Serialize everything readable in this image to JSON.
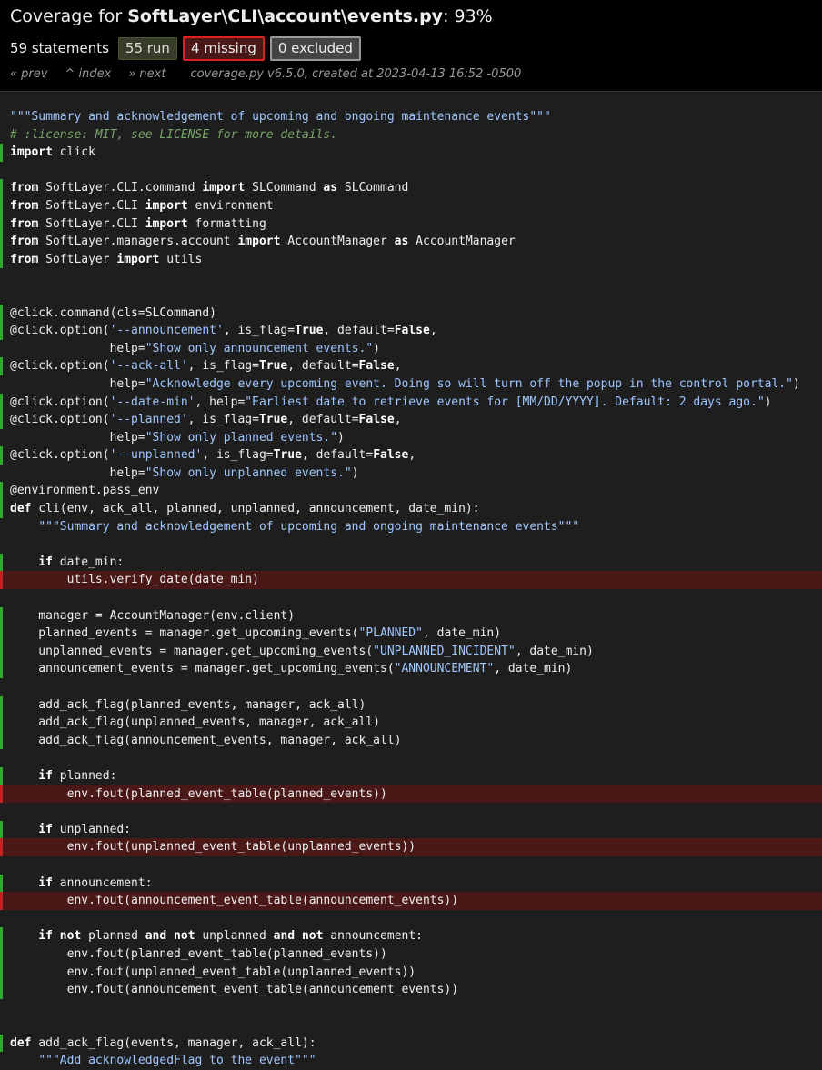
{
  "header": {
    "title_prefix": "Coverage for ",
    "file_path": "SoftLayer\\CLI\\account\\events.py",
    "title_suffix": ": 93%",
    "statements": "59 statements",
    "run_badge": "55 run",
    "missing_badge": "4 missing",
    "excluded_badge": "0 excluded",
    "nav_prev": "« prev",
    "nav_index": "^ index",
    "nav_next": "» next",
    "meta": "coverage.py v6.5.0, created at 2023-04-13 16:52 -0500"
  },
  "colors": {
    "run_marker": "#2ea82e",
    "missing_marker": "#c22323",
    "missing_background": "#4b1818",
    "header_background": "#000000",
    "page_background": "#1e1e1e"
  },
  "source_lines": [
    {
      "s": "",
      "t": [
        [
          "str",
          "\"\"\"Summary and acknowledgement of upcoming and ongoing maintenance events\"\"\""
        ]
      ]
    },
    {
      "s": "",
      "t": [
        [
          "com",
          "# :license: MIT, see LICENSE for more details."
        ]
      ]
    },
    {
      "s": "run",
      "t": [
        [
          "kw",
          "import"
        ],
        [
          "",
          " click"
        ]
      ]
    },
    {
      "s": "",
      "t": []
    },
    {
      "s": "run",
      "t": [
        [
          "kw",
          "from"
        ],
        [
          "",
          " SoftLayer.CLI.command "
        ],
        [
          "kw",
          "import"
        ],
        [
          "",
          " SLCommand "
        ],
        [
          "kw",
          "as"
        ],
        [
          "",
          " SLCommand"
        ]
      ]
    },
    {
      "s": "run",
      "t": [
        [
          "kw",
          "from"
        ],
        [
          "",
          " SoftLayer.CLI "
        ],
        [
          "kw",
          "import"
        ],
        [
          "",
          " environment"
        ]
      ]
    },
    {
      "s": "run",
      "t": [
        [
          "kw",
          "from"
        ],
        [
          "",
          " SoftLayer.CLI "
        ],
        [
          "kw",
          "import"
        ],
        [
          "",
          " formatting"
        ]
      ]
    },
    {
      "s": "run",
      "t": [
        [
          "kw",
          "from"
        ],
        [
          "",
          " SoftLayer.managers.account "
        ],
        [
          "kw",
          "import"
        ],
        [
          "",
          " AccountManager "
        ],
        [
          "kw",
          "as"
        ],
        [
          "",
          " AccountManager"
        ]
      ]
    },
    {
      "s": "run",
      "t": [
        [
          "kw",
          "from"
        ],
        [
          "",
          " SoftLayer "
        ],
        [
          "kw",
          "import"
        ],
        [
          "",
          " utils"
        ]
      ]
    },
    {
      "s": "",
      "t": []
    },
    {
      "s": "",
      "t": []
    },
    {
      "s": "run",
      "t": [
        [
          "",
          "@click.command(cls=SLCommand)"
        ]
      ]
    },
    {
      "s": "run",
      "t": [
        [
          "",
          "@click.option("
        ],
        [
          "str",
          "'--announcement'"
        ],
        [
          "",
          ", is_flag="
        ],
        [
          "kw",
          "True"
        ],
        [
          "",
          ", default="
        ],
        [
          "kw",
          "False"
        ],
        [
          "",
          ","
        ]
      ]
    },
    {
      "s": "",
      "t": [
        [
          "",
          "              help="
        ],
        [
          "str",
          "\"Show only announcement events.\""
        ],
        [
          "",
          ")"
        ]
      ]
    },
    {
      "s": "run",
      "t": [
        [
          "",
          "@click.option("
        ],
        [
          "str",
          "'--ack-all'"
        ],
        [
          "",
          ", is_flag="
        ],
        [
          "kw",
          "True"
        ],
        [
          "",
          ", default="
        ],
        [
          "kw",
          "False"
        ],
        [
          "",
          ","
        ]
      ]
    },
    {
      "s": "",
      "t": [
        [
          "",
          "              help="
        ],
        [
          "str",
          "\"Acknowledge every upcoming event. Doing so will turn off the popup in the control portal.\""
        ],
        [
          "",
          ")"
        ]
      ]
    },
    {
      "s": "run",
      "t": [
        [
          "",
          "@click.option("
        ],
        [
          "str",
          "'--date-min'"
        ],
        [
          "",
          ", help="
        ],
        [
          "str",
          "\"Earliest date to retrieve events for [MM/DD/YYYY]. Default: 2 days ago.\""
        ],
        [
          "",
          ")"
        ]
      ]
    },
    {
      "s": "run",
      "t": [
        [
          "",
          "@click.option("
        ],
        [
          "str",
          "'--planned'"
        ],
        [
          "",
          ", is_flag="
        ],
        [
          "kw",
          "True"
        ],
        [
          "",
          ", default="
        ],
        [
          "kw",
          "False"
        ],
        [
          "",
          ","
        ]
      ]
    },
    {
      "s": "",
      "t": [
        [
          "",
          "              help="
        ],
        [
          "str",
          "\"Show only planned events.\""
        ],
        [
          "",
          ")"
        ]
      ]
    },
    {
      "s": "run",
      "t": [
        [
          "",
          "@click.option("
        ],
        [
          "str",
          "'--unplanned'"
        ],
        [
          "",
          ", is_flag="
        ],
        [
          "kw",
          "True"
        ],
        [
          "",
          ", default="
        ],
        [
          "kw",
          "False"
        ],
        [
          "",
          ","
        ]
      ]
    },
    {
      "s": "",
      "t": [
        [
          "",
          "              help="
        ],
        [
          "str",
          "\"Show only unplanned events.\""
        ],
        [
          "",
          ")"
        ]
      ]
    },
    {
      "s": "run",
      "t": [
        [
          "",
          "@environment.pass_env"
        ]
      ]
    },
    {
      "s": "run",
      "t": [
        [
          "kw",
          "def"
        ],
        [
          "",
          " cli(env, ack_all, planned, unplanned, announcement, date_min):"
        ]
      ]
    },
    {
      "s": "",
      "t": [
        [
          "",
          "    "
        ],
        [
          "str",
          "\"\"\"Summary and acknowledgement of upcoming and ongoing maintenance events\"\"\""
        ]
      ]
    },
    {
      "s": "",
      "t": []
    },
    {
      "s": "run",
      "t": [
        [
          "",
          "    "
        ],
        [
          "kw",
          "if"
        ],
        [
          "",
          " date_min:"
        ]
      ]
    },
    {
      "s": "mis",
      "t": [
        [
          "",
          "        utils.verify_date(date_min)"
        ]
      ]
    },
    {
      "s": "",
      "t": []
    },
    {
      "s": "run",
      "t": [
        [
          "",
          "    manager = AccountManager(env.client)"
        ]
      ]
    },
    {
      "s": "run",
      "t": [
        [
          "",
          "    planned_events = manager.get_upcoming_events("
        ],
        [
          "str",
          "\"PLANNED\""
        ],
        [
          "",
          ", date_min)"
        ]
      ]
    },
    {
      "s": "run",
      "t": [
        [
          "",
          "    unplanned_events = manager.get_upcoming_events("
        ],
        [
          "str",
          "\"UNPLANNED_INCIDENT\""
        ],
        [
          "",
          ", date_min)"
        ]
      ]
    },
    {
      "s": "run",
      "t": [
        [
          "",
          "    announcement_events = manager.get_upcoming_events("
        ],
        [
          "str",
          "\"ANNOUNCEMENT\""
        ],
        [
          "",
          ", date_min)"
        ]
      ]
    },
    {
      "s": "",
      "t": []
    },
    {
      "s": "run",
      "t": [
        [
          "",
          "    add_ack_flag(planned_events, manager, ack_all)"
        ]
      ]
    },
    {
      "s": "run",
      "t": [
        [
          "",
          "    add_ack_flag(unplanned_events, manager, ack_all)"
        ]
      ]
    },
    {
      "s": "run",
      "t": [
        [
          "",
          "    add_ack_flag(announcement_events, manager, ack_all)"
        ]
      ]
    },
    {
      "s": "",
      "t": []
    },
    {
      "s": "run",
      "t": [
        [
          "",
          "    "
        ],
        [
          "kw",
          "if"
        ],
        [
          "",
          " planned:"
        ]
      ]
    },
    {
      "s": "mis",
      "t": [
        [
          "",
          "        env.fout(planned_event_table(planned_events))"
        ]
      ]
    },
    {
      "s": "",
      "t": []
    },
    {
      "s": "run",
      "t": [
        [
          "",
          "    "
        ],
        [
          "kw",
          "if"
        ],
        [
          "",
          " unplanned:"
        ]
      ]
    },
    {
      "s": "mis",
      "t": [
        [
          "",
          "        env.fout(unplanned_event_table(unplanned_events))"
        ]
      ]
    },
    {
      "s": "",
      "t": []
    },
    {
      "s": "run",
      "t": [
        [
          "",
          "    "
        ],
        [
          "kw",
          "if"
        ],
        [
          "",
          " announcement:"
        ]
      ]
    },
    {
      "s": "mis",
      "t": [
        [
          "",
          "        env.fout(announcement_event_table(announcement_events))"
        ]
      ]
    },
    {
      "s": "",
      "t": []
    },
    {
      "s": "run",
      "t": [
        [
          "",
          "    "
        ],
        [
          "kw",
          "if"
        ],
        [
          "",
          " "
        ],
        [
          "kw",
          "not"
        ],
        [
          "",
          " planned "
        ],
        [
          "kw",
          "and"
        ],
        [
          "",
          " "
        ],
        [
          "kw",
          "not"
        ],
        [
          "",
          " unplanned "
        ],
        [
          "kw",
          "and"
        ],
        [
          "",
          " "
        ],
        [
          "kw",
          "not"
        ],
        [
          "",
          " announcement:"
        ]
      ]
    },
    {
      "s": "run",
      "t": [
        [
          "",
          "        env.fout(planned_event_table(planned_events))"
        ]
      ]
    },
    {
      "s": "run",
      "t": [
        [
          "",
          "        env.fout(unplanned_event_table(unplanned_events))"
        ]
      ]
    },
    {
      "s": "run",
      "t": [
        [
          "",
          "        env.fout(announcement_event_table(announcement_events))"
        ]
      ]
    },
    {
      "s": "",
      "t": []
    },
    {
      "s": "",
      "t": []
    },
    {
      "s": "run",
      "t": [
        [
          "kw",
          "def"
        ],
        [
          "",
          " add_ack_flag(events, manager, ack_all):"
        ]
      ]
    },
    {
      "s": "",
      "t": [
        [
          "",
          "    "
        ],
        [
          "str",
          "\"\"\"Add acknowledgedFlag to the event\"\"\""
        ]
      ]
    }
  ]
}
